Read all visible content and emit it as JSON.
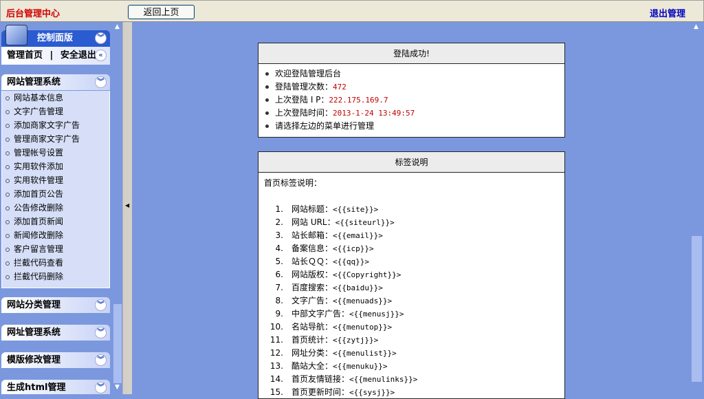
{
  "header": {
    "brand": "后台管理中心",
    "back_button": "返回上页",
    "logout": "退出管理"
  },
  "sidebar": {
    "control_panel": {
      "title": "控制面版",
      "home": "管理首页",
      "separator": "|",
      "safe_exit": "安全退出"
    },
    "sections": [
      {
        "title": "网站管理系统",
        "items": [
          "网站基本信息",
          "文字广告管理",
          "添加商家文字广告",
          "管理商家文字广告",
          "管理帐号设置",
          "实用软件添加",
          "实用软件管理",
          "添加首页公告",
          "公告修改删除",
          "添加首页新闻",
          "新闻修改删除",
          "客户留言管理",
          "拦截代码查看",
          "拦截代码删除"
        ]
      },
      {
        "title": "网站分类管理"
      },
      {
        "title": "网址管理系统"
      },
      {
        "title": "模版修改管理"
      },
      {
        "title": "生成html管理"
      }
    ]
  },
  "login_box": {
    "title": "登陆成功!",
    "items": [
      {
        "label": "欢迎登陆管理后台",
        "value": ""
      },
      {
        "label": "登陆管理次数：",
        "value": "472"
      },
      {
        "label": "上次登陆 I P：",
        "value": "222.175.169.7"
      },
      {
        "label": "上次登陆时间：",
        "value": "2013-1-24 13:49:57"
      },
      {
        "label": "请选择左边的菜单进行管理",
        "value": ""
      }
    ]
  },
  "tags_box": {
    "title": "标签说明",
    "intro": "首页标签说明：",
    "items": [
      {
        "n": "1.",
        "label": "网站标题：",
        "code": "<{{site}}>"
      },
      {
        "n": "2.",
        "label": "网站 URL：",
        "code": "<{{siteurl}}>"
      },
      {
        "n": "3.",
        "label": "站长邮箱：",
        "code": "<{{email}}>"
      },
      {
        "n": "4.",
        "label": "备案信息：",
        "code": "<{{icp}}>"
      },
      {
        "n": "5.",
        "label": "站长ＱＱ：",
        "code": "<{{qq}}>"
      },
      {
        "n": "6.",
        "label": "网站版权：",
        "code": "<{{Copyright}}>"
      },
      {
        "n": "7.",
        "label": "百度搜索：",
        "code": "<{{baidu}}>"
      },
      {
        "n": "8.",
        "label": "文字广告：",
        "code": "<{{menuads}}>"
      },
      {
        "n": "9.",
        "label": "中部文字广告：",
        "code": "<{{menusj}}>"
      },
      {
        "n": "10.",
        "label": "名站导航：",
        "code": "<{{menutop}}>"
      },
      {
        "n": "11.",
        "label": "首页统计：",
        "code": "<{{zytj}}>"
      },
      {
        "n": "12.",
        "label": "网址分类：",
        "code": "<{{menulist}}>"
      },
      {
        "n": "13.",
        "label": "酷站大全：",
        "code": "<{{menuku}}>"
      },
      {
        "n": "14.",
        "label": "首页友情链接：",
        "code": "<{{menulinks}}>"
      },
      {
        "n": "15.",
        "label": "首页更新时间：",
        "code": "<{{sysj}}>"
      }
    ]
  },
  "colors": {
    "top_bg": "#ece9d8",
    "page_bg": "#7b98de",
    "brand": "#d00000",
    "logout": "#0000c0",
    "value": "#c00000"
  }
}
